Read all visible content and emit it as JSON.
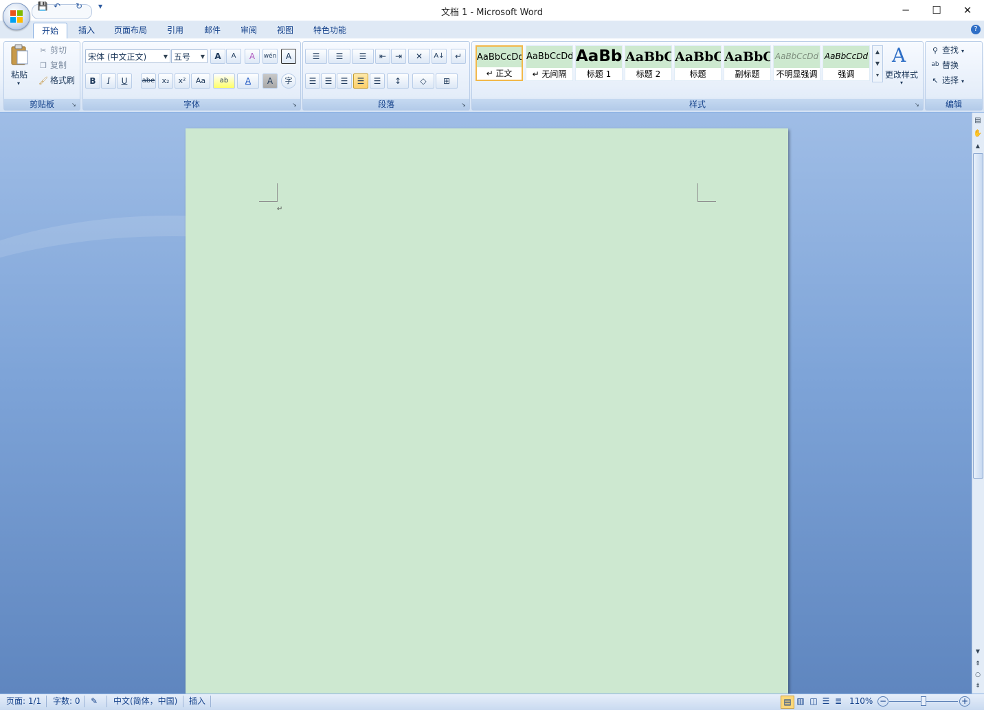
{
  "window": {
    "title": "文档 1 - Microsoft Word",
    "minimize_glyph": "─",
    "maximize_glyph": "☐",
    "close_glyph": "✕"
  },
  "qat": {
    "save_icon": "💾",
    "undo_icon": "↶",
    "redo_icon": "↻",
    "more_icon": "▾"
  },
  "tabs": [
    {
      "label": "开始",
      "active": true
    },
    {
      "label": "插入"
    },
    {
      "label": "页面布局"
    },
    {
      "label": "引用"
    },
    {
      "label": "邮件"
    },
    {
      "label": "审阅"
    },
    {
      "label": "视图"
    },
    {
      "label": "特色功能"
    }
  ],
  "help_icon": "?",
  "clipboard": {
    "paste": "粘贴",
    "cut": "剪切",
    "copy": "复制",
    "format_painter": "格式刷",
    "label": "剪贴板"
  },
  "font": {
    "font_name": "宋体 (中文正文)",
    "font_size": "五号",
    "label": "字体",
    "grow": "A",
    "shrink": "A",
    "clear": "A",
    "phonetic": "wén",
    "border": "A",
    "bold": "B",
    "italic": "I",
    "underline": "U",
    "strike": "abe",
    "sub": "x₂",
    "sup": "x²",
    "case": "Aa",
    "highlight": "ab",
    "color": "A",
    "shade": "A",
    "enclose": "字"
  },
  "paragraph": {
    "label": "段落",
    "bullets": "☰",
    "numbering": "☰",
    "multilevel": "☰",
    "decrease_indent": "⇤",
    "increase_indent": "⇥",
    "chinese_layout": "✕",
    "sort": "A↓",
    "show_marks": "↵",
    "align_left": "☰",
    "center": "☰",
    "align_right": "☰",
    "justify": "☰",
    "distributed": "☰",
    "line_spacing": "↕",
    "shading": "◇",
    "borders": "⊞"
  },
  "styles": {
    "label": "样式",
    "items": [
      {
        "preview": "AaBbCcDd",
        "name": "↵ 正文"
      },
      {
        "preview": "AaBbCcDd",
        "name": "↵ 无间隔"
      },
      {
        "preview": "AaBb",
        "name": "标题 1"
      },
      {
        "preview": "AaBbC",
        "name": "标题 2"
      },
      {
        "preview": "AaBbC",
        "name": "标题"
      },
      {
        "preview": "AaBbC",
        "name": "副标题"
      },
      {
        "preview": "AaBbCcDd",
        "name": "不明显强调"
      },
      {
        "preview": "AaBbCcDd",
        "name": "强调"
      }
    ],
    "change_styles": "更改样式"
  },
  "editing": {
    "label": "编辑",
    "find": "查找",
    "replace": "替换",
    "select": "选择"
  },
  "document": {
    "paragraph_mark": "↵"
  },
  "statusbar": {
    "page": "页面: 1/1",
    "words": "字数: 0",
    "language": "中文(简体，中国)",
    "mode": "插入",
    "zoom": "110%"
  },
  "colors": {
    "page_bg": "#cde8d0",
    "accent": "#15428b",
    "workspace": "#7ea4d8"
  }
}
